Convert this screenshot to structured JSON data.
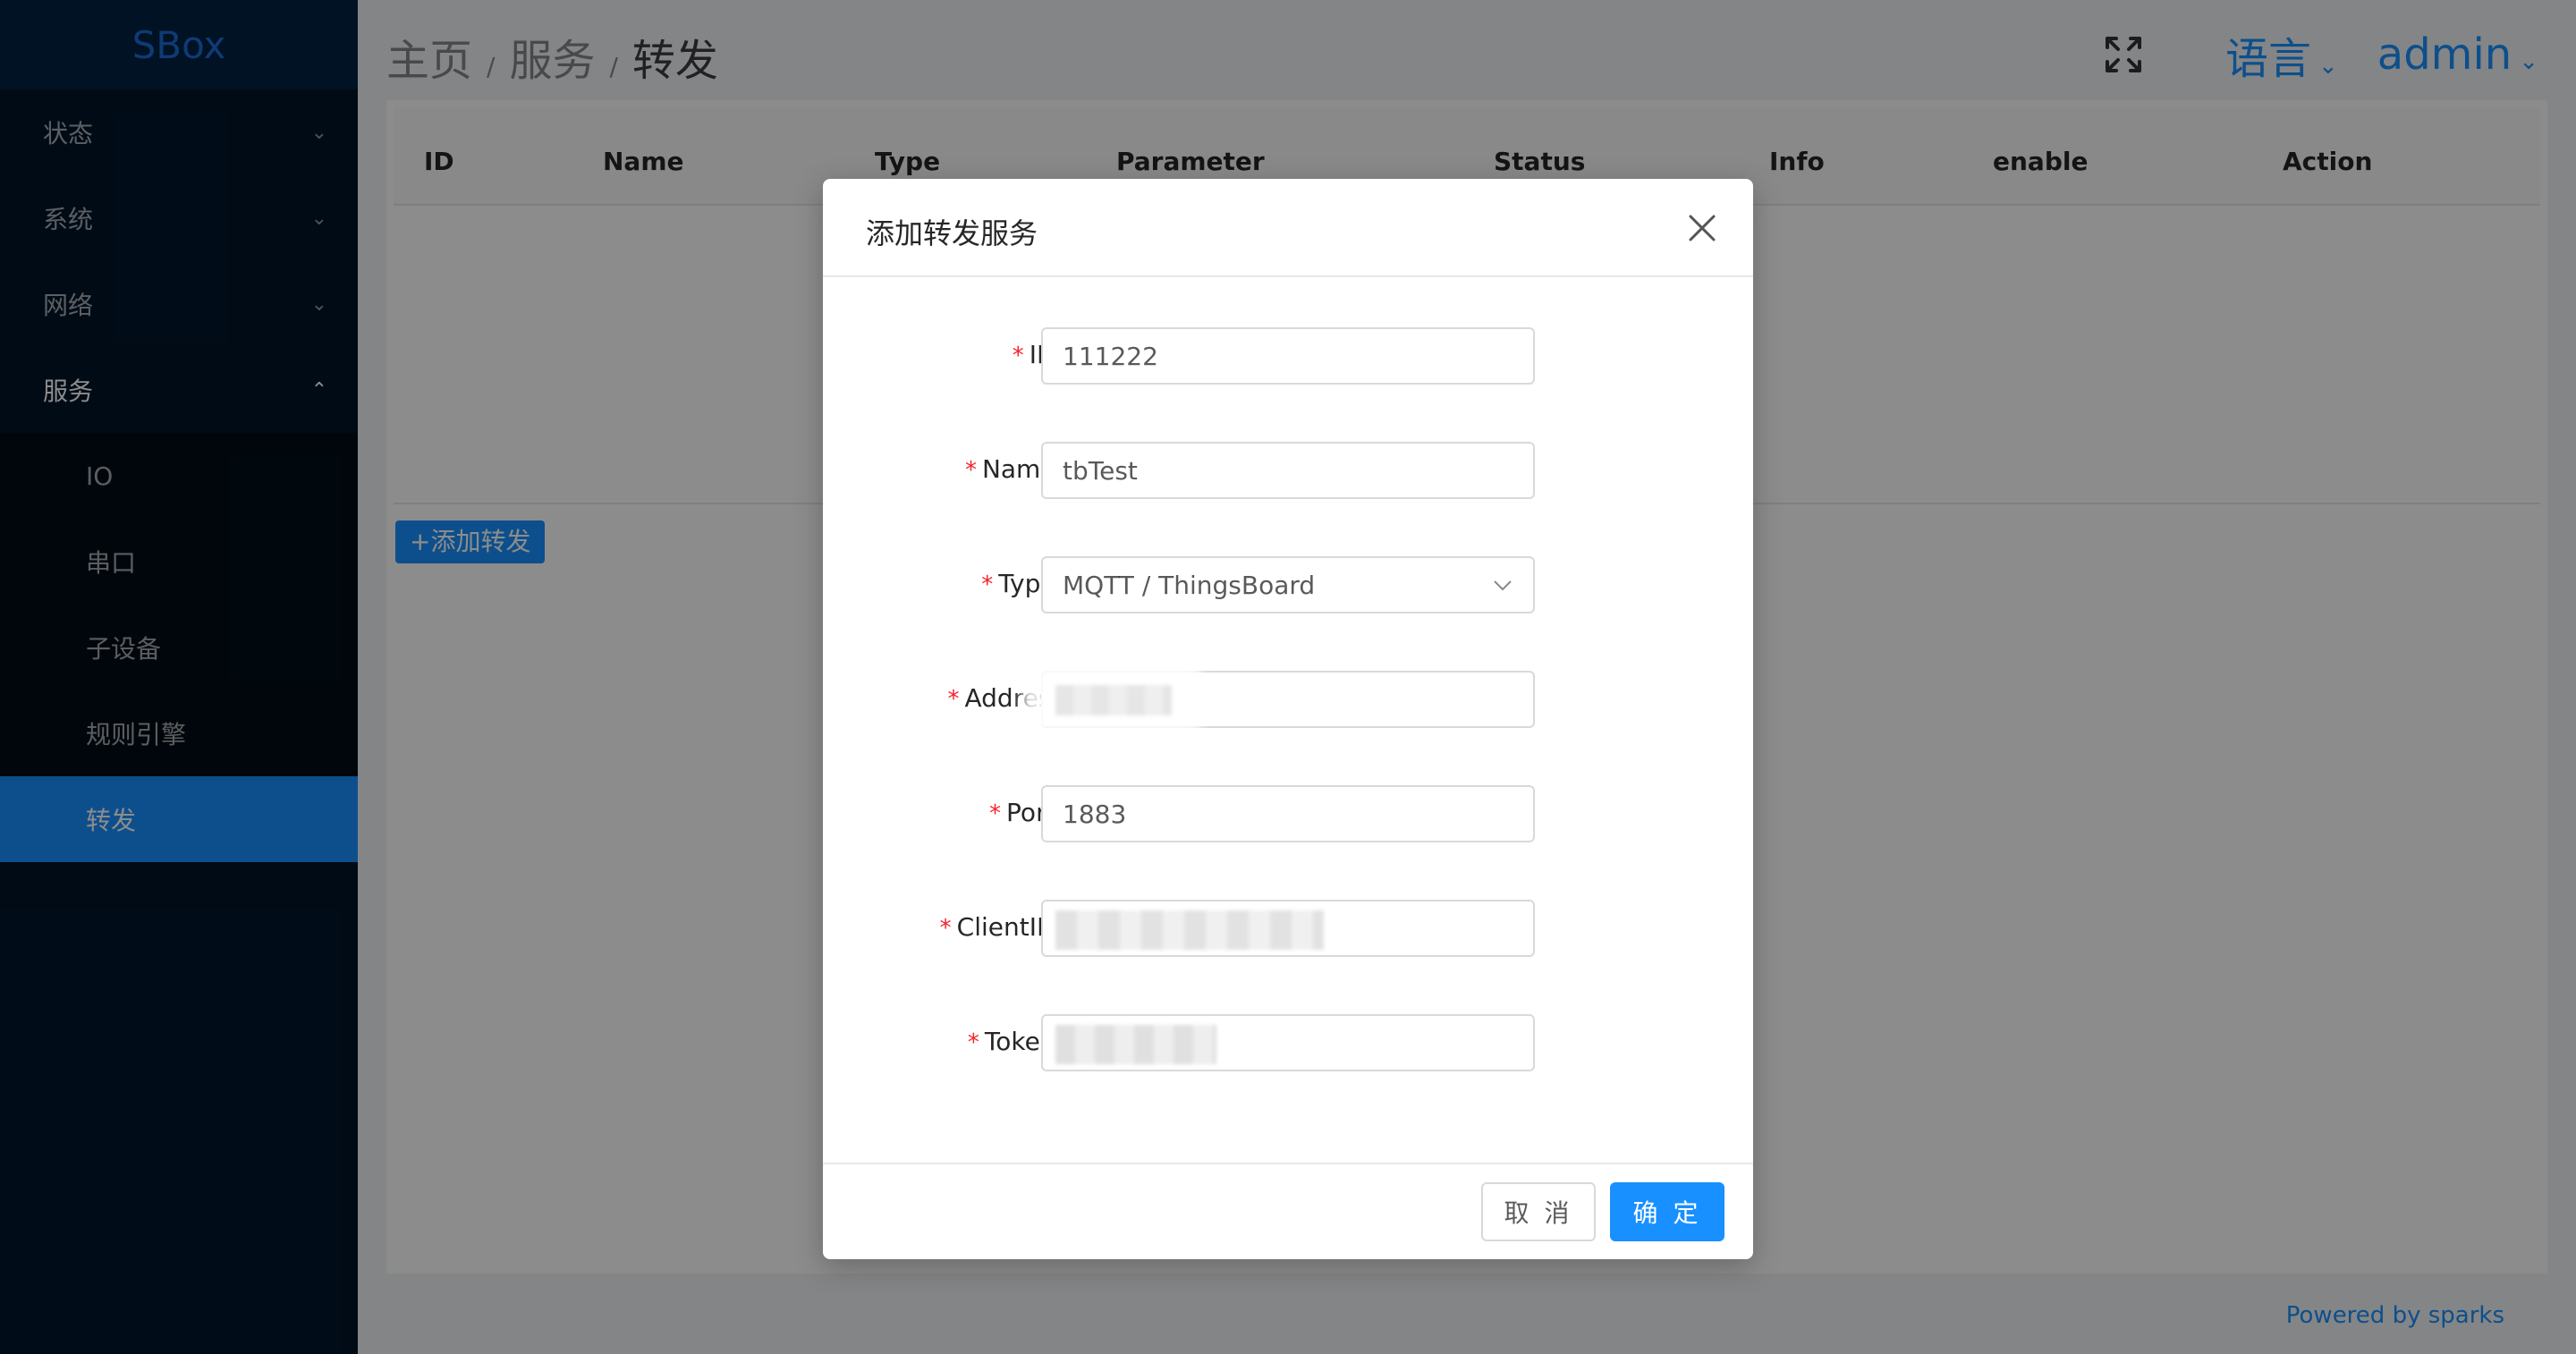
{
  "app": {
    "logo": "SBox"
  },
  "sidebar": {
    "menus": [
      {
        "label": "状态",
        "expanded": false
      },
      {
        "label": "系统",
        "expanded": false
      },
      {
        "label": "网络",
        "expanded": false
      },
      {
        "label": "服务",
        "expanded": true
      }
    ],
    "sub_items": [
      {
        "label": "IO"
      },
      {
        "label": "串口"
      },
      {
        "label": "子设备"
      },
      {
        "label": "规则引擎"
      },
      {
        "label": "转发",
        "active": true
      }
    ]
  },
  "header": {
    "breadcrumb": [
      "主页",
      "服务",
      "转发"
    ],
    "separator": "/",
    "language_label": "语言",
    "user_label": "admin",
    "icons": {
      "fullscreen": "fullscreen-icon",
      "dropdown": "chevron-down-icon"
    }
  },
  "table": {
    "columns": [
      "ID",
      "Name",
      "Type",
      "Parameter",
      "Status",
      "Info",
      "enable",
      "Action"
    ]
  },
  "add_button_label": "+添加转发",
  "footer": {
    "text": "Powered by sparks"
  },
  "modal": {
    "title": "添加转发服务",
    "fields": {
      "id": {
        "label": "ID",
        "value": "111222"
      },
      "name": {
        "label": "Name",
        "value": "tbTest"
      },
      "type": {
        "label": "Type",
        "value": "MQTT / ThingsBoard"
      },
      "address": {
        "label": "Address",
        "value": ""
      },
      "port": {
        "label": "Port",
        "value": "1883"
      },
      "client_id": {
        "label": "ClientID",
        "value": ""
      },
      "token": {
        "label": "Token",
        "value": ""
      }
    },
    "cancel_label": "取 消",
    "ok_label": "确 定"
  },
  "colors": {
    "sidebar_bg": "#001529",
    "accent": "#1890ff",
    "required": "#f5222d",
    "mask": "rgba(0,0,0,0.45)"
  }
}
